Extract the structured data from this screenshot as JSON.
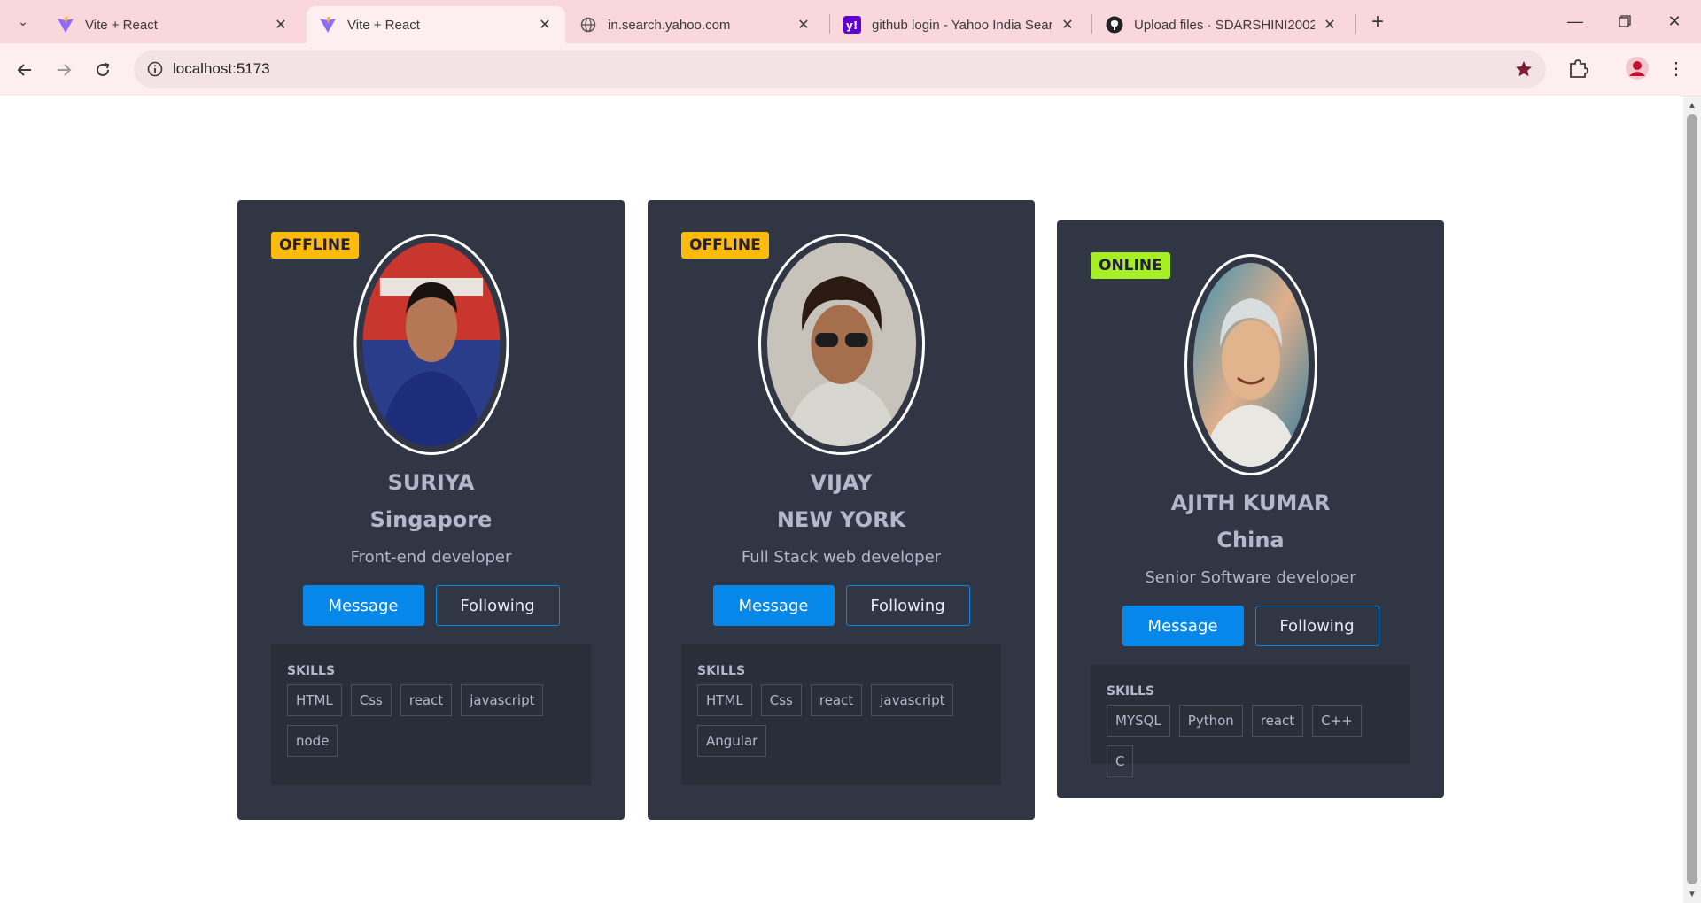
{
  "browser": {
    "tabs": [
      {
        "title": "Vite + React",
        "favicon": "vite-icon",
        "active": false
      },
      {
        "title": "Vite + React",
        "favicon": "vite-icon",
        "active": true
      },
      {
        "title": "in.search.yahoo.com",
        "favicon": "globe-icon",
        "active": false
      },
      {
        "title": "github login - Yahoo India Sear",
        "favicon": "yahoo-icon",
        "active": false
      },
      {
        "title": "Upload files · SDARSHINI2002/",
        "favicon": "github-icon",
        "active": false
      }
    ],
    "address": "localhost:5173",
    "colors": {
      "tabstrip": "#f9d7dc",
      "toolbar": "#fdeef0"
    }
  },
  "cards": [
    {
      "status": "OFFLINE",
      "name": "SURIYA",
      "city": "Singapore",
      "role": "Front-end developer",
      "message_label": "Message",
      "following_label": "Following",
      "skills_title": "SKILLS",
      "skills": [
        "HTML",
        "Css",
        "react",
        "javascript",
        "node"
      ],
      "avatar": "profile-photo"
    },
    {
      "status": "OFFLINE",
      "name": "VIJAY",
      "city": "NEW YORK",
      "role": "Full Stack web developer",
      "message_label": "Message",
      "following_label": "Following",
      "skills_title": "SKILLS",
      "skills": [
        "HTML",
        "Css",
        "react",
        "javascript",
        "Angular"
      ],
      "avatar": "profile-photo"
    },
    {
      "status": "ONLINE",
      "name": "AJITH KUMAR",
      "city": "China",
      "role": "Senior Software developer",
      "message_label": "Message",
      "following_label": "Following",
      "skills_title": "SKILLS",
      "skills": [
        "MYSQL",
        "Python",
        "react",
        "C++",
        "C"
      ],
      "avatar": "profile-photo"
    }
  ],
  "theme": {
    "card_bg": "#313644",
    "skills_bg": "#2a2e39",
    "text": "#b3b8cd",
    "primary": "#0588ea",
    "offline": "#febb0b",
    "online": "#a6ef26"
  }
}
